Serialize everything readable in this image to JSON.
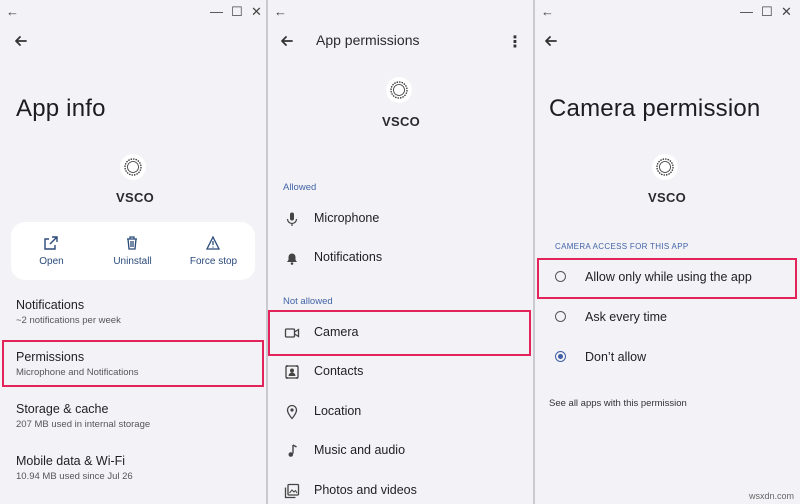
{
  "panel1": {
    "title": "App info",
    "app_name": "VSCO",
    "actions": [
      {
        "label": "Open",
        "icon": "open-external-icon"
      },
      {
        "label": "Uninstall",
        "icon": "trash-icon"
      },
      {
        "label": "Force stop",
        "icon": "warning-icon"
      }
    ],
    "rows": [
      {
        "title": "Notifications",
        "subtitle": "~2 notifications per week"
      },
      {
        "title": "Permissions",
        "subtitle": "Microphone and Notifications"
      },
      {
        "title": "Storage & cache",
        "subtitle": "207 MB used in internal storage"
      },
      {
        "title": "Mobile data & Wi-Fi",
        "subtitle": "10.94 MB used since Jul 26"
      }
    ]
  },
  "panel2": {
    "title": "App permissions",
    "app_name": "VSCO",
    "allowed_label": "Allowed",
    "allowed": [
      {
        "label": "Microphone",
        "icon": "microphone-icon"
      },
      {
        "label": "Notifications",
        "icon": "bell-icon"
      }
    ],
    "not_allowed_label": "Not allowed",
    "not_allowed": [
      {
        "label": "Camera",
        "icon": "camera-icon"
      },
      {
        "label": "Contacts",
        "icon": "contacts-icon"
      },
      {
        "label": "Location",
        "icon": "location-icon"
      },
      {
        "label": "Music and audio",
        "icon": "music-icon"
      },
      {
        "label": "Photos and videos",
        "icon": "photos-icon"
      }
    ]
  },
  "panel3": {
    "title": "Camera permission",
    "app_name": "VSCO",
    "section_label": "CAMERA ACCESS FOR THIS APP",
    "options": [
      {
        "label": "Allow only while using the app",
        "selected": false
      },
      {
        "label": "Ask every time",
        "selected": false
      },
      {
        "label": "Don’t allow",
        "selected": true
      }
    ],
    "see_all": "See all apps with this permission"
  },
  "colors": {
    "highlight": "#e3245b",
    "accent": "#3e5fa6",
    "panel_bg": "#f3f2f6"
  },
  "watermark": "wsxdn.com"
}
